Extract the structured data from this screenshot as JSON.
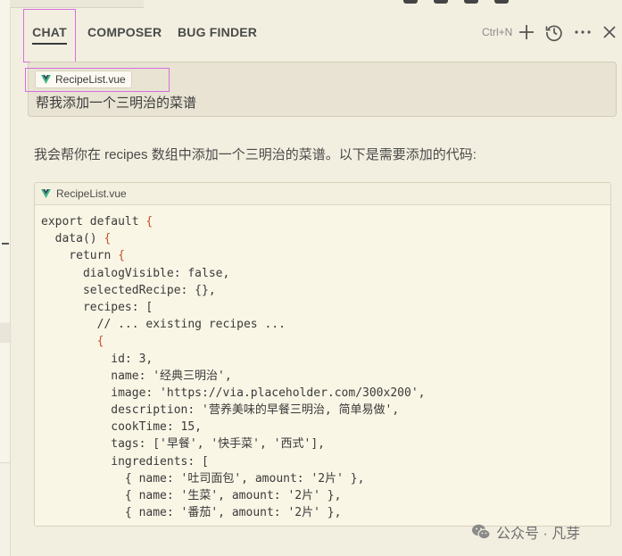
{
  "tabs": [
    {
      "label": "CHAT",
      "active": true
    },
    {
      "label": "COMPOSER",
      "active": false
    },
    {
      "label": "BUG FINDER",
      "active": false
    }
  ],
  "toolbar": {
    "new_chat_shortcut": "Ctrl+N",
    "icons": [
      "plus-icon",
      "history-icon",
      "more-icon",
      "close-icon"
    ]
  },
  "user_message": {
    "attachment": "RecipeList.vue",
    "text": "帮我添加一个三明治的菜谱"
  },
  "assistant_message": {
    "text": "我会帮你在 recipes 数组中添加一个三明治的菜谱。以下是需要添加的代码:"
  },
  "code_block": {
    "filename": "RecipeList.vue",
    "lines": [
      "export default {",
      "  data() {",
      "    return {",
      "      dialogVisible: false,",
      "      selectedRecipe: {},",
      "      recipes: [",
      "        // ... existing recipes ...",
      "        {",
      "          id: 3,",
      "          name: '经典三明治',",
      "          image: 'https://via.placeholder.com/300x200',",
      "          description: '营养美味的早餐三明治, 简单易做',",
      "          cookTime: 15,",
      "          tags: ['早餐', '快手菜', '西式'],",
      "          ingredients: [",
      "            { name: '吐司面包', amount: '2片' },",
      "            { name: '生菜', amount: '2片' },",
      "            { name: '番茄', amount: '2片' },"
    ]
  },
  "watermark": "公众号 · 凡芽",
  "colors": {
    "background": "#f3efe0",
    "highlight_outline": "#d86ee0",
    "brace": "#c2512d",
    "vue_green": "#41b883"
  }
}
